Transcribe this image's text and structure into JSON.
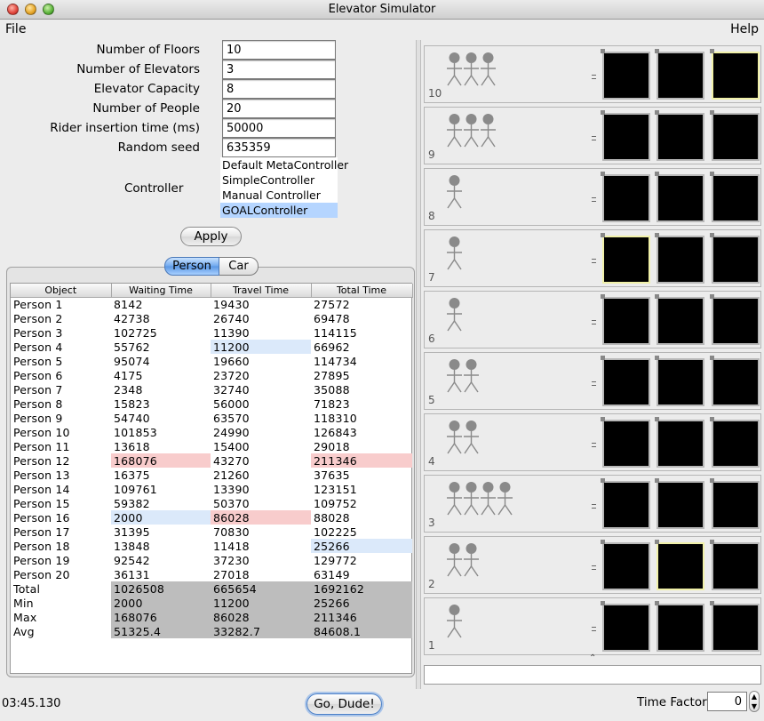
{
  "window": {
    "title": "Elevator Simulator"
  },
  "menu": {
    "file": "File",
    "help": "Help"
  },
  "settings": {
    "fields": [
      {
        "label": "Number of Floors",
        "value": "10"
      },
      {
        "label": "Number of Elevators",
        "value": "3"
      },
      {
        "label": "Elevator Capacity",
        "value": "8"
      },
      {
        "label": "Number of People",
        "value": "20"
      },
      {
        "label": "Rider insertion time (ms)",
        "value": "50000"
      },
      {
        "label": "Random seed",
        "value": "635359"
      }
    ],
    "controller_label": "Controller",
    "controllers": [
      "Default MetaController",
      "SimpleController",
      "Manual Controller",
      "GOALController"
    ],
    "selected_controller": "GOALController",
    "apply_label": "Apply"
  },
  "tabs": {
    "person": "Person",
    "car": "Car",
    "active": "Person"
  },
  "table": {
    "headers": [
      "Object",
      "Waiting Time",
      "Travel Time",
      "Total Time"
    ],
    "rows": [
      {
        "object": "Person 1",
        "waiting": "8142",
        "travel": "19430",
        "total": "27572"
      },
      {
        "object": "Person 2",
        "waiting": "42738",
        "travel": "26740",
        "total": "69478"
      },
      {
        "object": "Person 3",
        "waiting": "102725",
        "travel": "11390",
        "total": "114115"
      },
      {
        "object": "Person 4",
        "waiting": "55762",
        "travel": "11200",
        "total": "66962",
        "hl": {
          "travel": "blue"
        }
      },
      {
        "object": "Person 5",
        "waiting": "95074",
        "travel": "19660",
        "total": "114734"
      },
      {
        "object": "Person 6",
        "waiting": "4175",
        "travel": "23720",
        "total": "27895"
      },
      {
        "object": "Person 7",
        "waiting": "2348",
        "travel": "32740",
        "total": "35088"
      },
      {
        "object": "Person 8",
        "waiting": "15823",
        "travel": "56000",
        "total": "71823"
      },
      {
        "object": "Person 9",
        "waiting": "54740",
        "travel": "63570",
        "total": "118310"
      },
      {
        "object": "Person 10",
        "waiting": "101853",
        "travel": "24990",
        "total": "126843"
      },
      {
        "object": "Person 11",
        "waiting": "13618",
        "travel": "15400",
        "total": "29018"
      },
      {
        "object": "Person 12",
        "waiting": "168076",
        "travel": "43270",
        "total": "211346",
        "hl": {
          "waiting": "red",
          "total": "red"
        }
      },
      {
        "object": "Person 13",
        "waiting": "16375",
        "travel": "21260",
        "total": "37635"
      },
      {
        "object": "Person 14",
        "waiting": "109761",
        "travel": "13390",
        "total": "123151"
      },
      {
        "object": "Person 15",
        "waiting": "59382",
        "travel": "50370",
        "total": "109752"
      },
      {
        "object": "Person 16",
        "waiting": "2000",
        "travel": "86028",
        "total": "88028",
        "hl": {
          "waiting": "blue",
          "travel": "red"
        }
      },
      {
        "object": "Person 17",
        "waiting": "31395",
        "travel": "70830",
        "total": "102225"
      },
      {
        "object": "Person 18",
        "waiting": "13848",
        "travel": "11418",
        "total": "25266",
        "hl": {
          "total": "blue"
        }
      },
      {
        "object": "Person 19",
        "waiting": "92542",
        "travel": "37230",
        "total": "129772"
      },
      {
        "object": "Person 20",
        "waiting": "36131",
        "travel": "27018",
        "total": "63149"
      }
    ],
    "summary": [
      {
        "object": "Total",
        "waiting": "1026508",
        "travel": "665654",
        "total": "1692162"
      },
      {
        "object": "Min",
        "waiting": "2000",
        "travel": "11200",
        "total": "25266"
      },
      {
        "object": "Max",
        "waiting": "168076",
        "travel": "86028",
        "total": "211346"
      },
      {
        "object": "Avg",
        "waiting": "51325.4",
        "travel": "33282.7",
        "total": "84608.1"
      }
    ]
  },
  "footer": {
    "clock": "03:45.130",
    "go_label": "Go, Dude!",
    "time_factor_label": "Time Factor",
    "time_factor_value": "0"
  },
  "building": {
    "floors": [
      {
        "number": "10",
        "waiting": 3,
        "highlighted_car": 3
      },
      {
        "number": "9",
        "waiting": 3,
        "highlighted_car": 0
      },
      {
        "number": "8",
        "waiting": 1,
        "highlighted_car": 0
      },
      {
        "number": "7",
        "waiting": 1,
        "highlighted_car": 1
      },
      {
        "number": "6",
        "waiting": 1,
        "highlighted_car": 0
      },
      {
        "number": "5",
        "waiting": 2,
        "highlighted_car": 0
      },
      {
        "number": "4",
        "waiting": 2,
        "highlighted_car": 0
      },
      {
        "number": "3",
        "waiting": 4,
        "highlighted_car": 0
      },
      {
        "number": "2",
        "waiting": 2,
        "highlighted_car": 2
      },
      {
        "number": "1",
        "waiting": 1,
        "highlighted_car": 0
      }
    ],
    "elevators": 3,
    "colors": {
      "car": "#000000",
      "highlight": "#f0f0a8",
      "person": "#8a8a8a"
    }
  }
}
